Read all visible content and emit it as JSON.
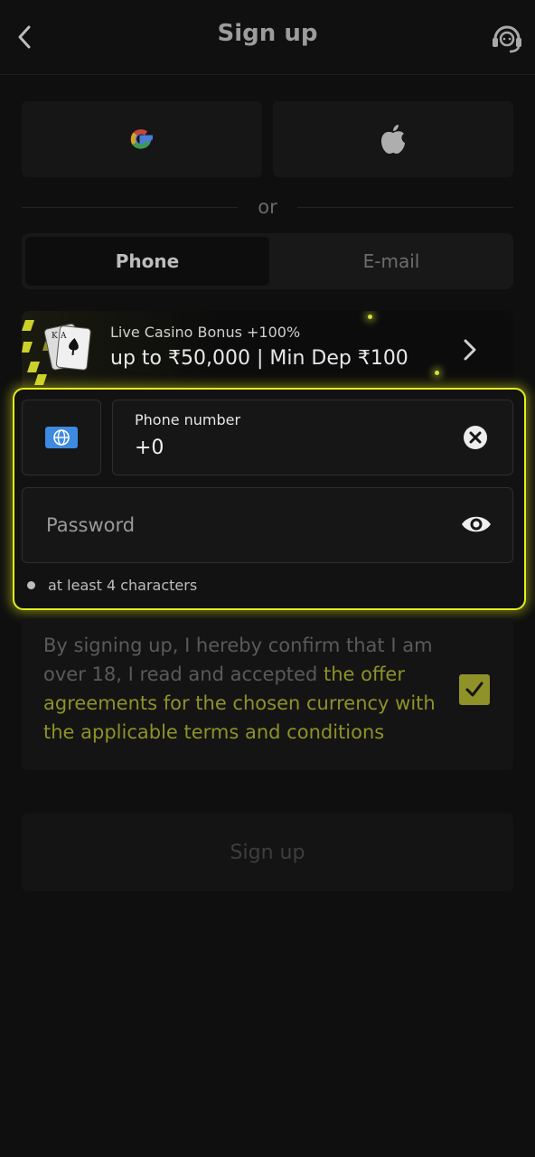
{
  "header": {
    "title": "Sign up",
    "back_icon": "chevron-left-icon",
    "support_icon": "headset-support-icon"
  },
  "social": {
    "google_icon": "google-icon",
    "apple_icon": "apple-icon"
  },
  "divider": {
    "text": "or"
  },
  "tabs": [
    {
      "label": "Phone",
      "active": true
    },
    {
      "label": "E-mail",
      "active": false
    }
  ],
  "promo": {
    "line1": "Live Casino Bonus +100%",
    "line2": "up to ₹50,000 | Min Dep ₹100",
    "icon": "chevron-right-icon"
  },
  "form": {
    "country_icon": "globe-icon",
    "phone_label": "Phone number",
    "phone_value": "+0",
    "clear_icon": "clear-circle-icon",
    "password_placeholder": "Password",
    "eye_icon": "eye-icon",
    "hint": "at least 4 characters"
  },
  "agreement": {
    "text_plain": "By signing up, I hereby confirm that I am over 18, I read and accepted ",
    "text_link": "the offer agreements for the chosen currency with the applicable terms and conditions",
    "checked": true
  },
  "submit": {
    "label": "Sign up"
  },
  "colors": {
    "accent": "#e4ec1c",
    "accent_dim": "#8e9228",
    "background": "#0f0f0f",
    "globe_chip": "#3d8ae0"
  }
}
